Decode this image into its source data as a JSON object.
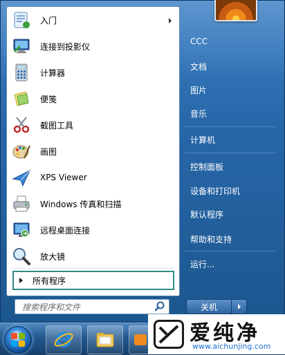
{
  "programs": [
    {
      "label": "入门",
      "icon": "getting-started-icon",
      "has_submenu": true
    },
    {
      "label": "连接到投影仪",
      "icon": "projector-icon",
      "has_submenu": false
    },
    {
      "label": "计算器",
      "icon": "calculator-icon",
      "has_submenu": false
    },
    {
      "label": "便笺",
      "icon": "sticky-notes-icon",
      "has_submenu": false
    },
    {
      "label": "截图工具",
      "icon": "snipping-tool-icon",
      "has_submenu": false
    },
    {
      "label": "画图",
      "icon": "paint-icon",
      "has_submenu": false
    },
    {
      "label": "XPS Viewer",
      "icon": "xps-viewer-icon",
      "has_submenu": false
    },
    {
      "label": "Windows 传真和扫描",
      "icon": "fax-scan-icon",
      "has_submenu": false
    },
    {
      "label": "远程桌面连接",
      "icon": "remote-desktop-icon",
      "has_submenu": false
    },
    {
      "label": "放大镜",
      "icon": "magnifier-icon",
      "has_submenu": false
    }
  ],
  "all_programs": "所有程序",
  "search": {
    "placeholder": "搜索程序和文件"
  },
  "right_items": [
    {
      "label": "CCC"
    },
    {
      "label": "文档"
    },
    {
      "label": "图片"
    },
    {
      "label": "音乐"
    },
    {
      "label": "计算机"
    },
    {
      "label": "控制面板"
    },
    {
      "label": "设备和打印机"
    },
    {
      "label": "默认程序"
    },
    {
      "label": "帮助和支持"
    },
    {
      "label": "运行..."
    }
  ],
  "shutdown": {
    "label": "关机"
  },
  "taskbar": {
    "items": [
      "start-orb",
      "internet-explorer-icon",
      "file-explorer-icon"
    ]
  },
  "watermark": {
    "title": "爱纯净",
    "url": "www.aichunjing.com"
  },
  "colors": {
    "menu_blue": "#2766a8",
    "taskbar_blue": "#22578e",
    "focus_border": "#2e8c86"
  }
}
